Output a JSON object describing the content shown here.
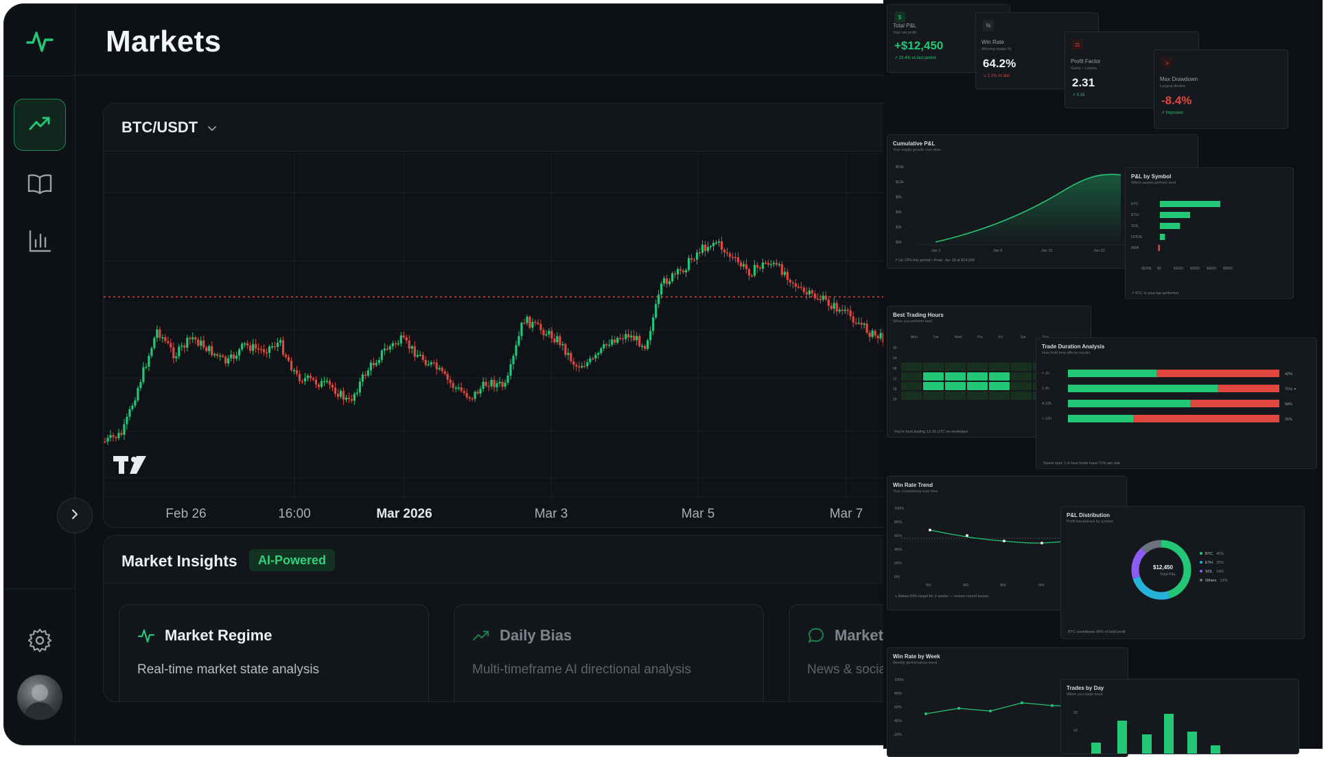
{
  "header": {
    "title": "Markets"
  },
  "symbol_selector": {
    "value": "BTC/USDT"
  },
  "chart_data": {
    "type": "candlestick",
    "symbol": "BTC/USDT",
    "x_tick_labels": [
      "Feb 26",
      "16:00",
      "Mar 2026",
      "Mar 3",
      "Mar 5",
      "Mar 7"
    ],
    "x_tick_bold": [
      false,
      false,
      true,
      false,
      false,
      false
    ],
    "reference_line_color": "#e0473f",
    "up_color": "#22c875",
    "down_color": "#e0473f",
    "close_path_approx": [
      0.85,
      0.82,
      0.62,
      0.42,
      0.52,
      0.45,
      0.5,
      0.55,
      0.48,
      0.5,
      0.47,
      0.6,
      0.62,
      0.64,
      0.7,
      0.58,
      0.5,
      0.46,
      0.52,
      0.57,
      0.64,
      0.68,
      0.62,
      0.64,
      0.38,
      0.42,
      0.46,
      0.56,
      0.54,
      0.46,
      0.44,
      0.48,
      0.24,
      0.2,
      0.12,
      0.08,
      0.15,
      0.2,
      0.16,
      0.2,
      0.28,
      0.3,
      0.34,
      0.38,
      0.44,
      0.46,
      0.47,
      0.49
    ]
  },
  "insights": {
    "title": "Market Insights",
    "badge": "AI-Powered",
    "cards": [
      {
        "title": "Market Regime",
        "desc": "Real-time market state analysis"
      },
      {
        "title": "Daily Bias",
        "desc": "Multi-timeframe AI directional analysis"
      },
      {
        "title": "Market S",
        "desc": "News & socia"
      }
    ]
  },
  "collage": {
    "stats": [
      {
        "label": "Total P&L",
        "sub": "Your net profit",
        "value": "+$12,450",
        "delta": "↗ 23.4% vs last period",
        "color": "#22c875"
      },
      {
        "label": "Win Rate",
        "sub": "Winning trades %",
        "value": "64.2%",
        "delta": "↘ 2.1% vs last",
        "color": "#e0473f"
      },
      {
        "label": "Profit Factor",
        "sub": "Gains ÷ Losses",
        "value": "2.31",
        "delta": "↗ 0.15",
        "color": "#22c875"
      },
      {
        "label": "Max Drawdown",
        "sub": "Largest decline",
        "value": "-8.4%",
        "delta": "↗ Improved",
        "color": "#22c875"
      }
    ],
    "cumulative": {
      "title": "Cumulative P&L",
      "sub": "Your equity growth over time",
      "y_ticks": [
        "$15k",
        "$12k",
        "$9k",
        "$6k",
        "$3k",
        "$0k"
      ],
      "x_ticks": [
        "Jan 1",
        "Jan 8",
        "Jan 15",
        "Jan 22"
      ],
      "footer": "↗ Up 23% this period • Peak: Jan 18 at $14,200"
    },
    "by_symbol": {
      "title": "P&L by Symbol",
      "sub": "Which assets perform best",
      "symbols": [
        "BTC",
        "ETH",
        "SOL",
        "DOGE",
        "ARB"
      ],
      "values": [
        4200,
        2100,
        1400,
        350,
        -120
      ],
      "x_ticks": [
        "-$1000",
        "$0",
        "$1000",
        "$2000",
        "$4000",
        "$5000"
      ],
      "footer": "↗ BTC is your top performer"
    },
    "hours": {
      "title": "Best Trading Hours",
      "sub": "When you perform best",
      "days": [
        "Mon",
        "Tue",
        "Wed",
        "Thu",
        "Fri",
        "Sat",
        "Sun"
      ],
      "hours": [
        "00",
        "04",
        "08",
        "12",
        "16",
        "20"
      ],
      "footer": "You're best trading 12-16 UTC on weekdays"
    },
    "duration": {
      "title": "Trade Duration Analysis",
      "sub": "How hold time affects results",
      "rows": [
        {
          "label": "< 1h",
          "win": 42,
          "text": "42%"
        },
        {
          "label": "1-4h",
          "win": 71,
          "text": "71% ✦"
        },
        {
          "label": "4-12h",
          "win": 58,
          "text": "58%"
        },
        {
          "label": "> 12h",
          "win": 31,
          "text": "31%"
        }
      ],
      "footer": "Sweet spot: 1-4 hour holds have 71% win rate"
    },
    "win_trend": {
      "title": "Win Rate Trend",
      "sub": "Your consistency over time",
      "y_ticks": [
        "100%",
        "80%",
        "60%",
        "40%",
        "20%",
        "0%"
      ],
      "x_ticks": [
        "W1",
        "W2",
        "W3",
        "W4"
      ],
      "footer": "↘ Below 60% target for 2 weeks — review recent losses"
    },
    "distribution": {
      "title": "P&L Distribution",
      "sub": "Profit breakdown by symbol",
      "center_value": "$12,450",
      "center_label": "Total P&L",
      "legend": [
        {
          "name": "BTC",
          "pct": "45%",
          "color": "#22c875"
        },
        {
          "name": "ETH",
          "pct": "25%",
          "color": "#26b3d9"
        },
        {
          "name": "SOL",
          "pct": "18%",
          "color": "#8b5cf6"
        },
        {
          "name": "Others",
          "pct": "12%",
          "color": "#6b7280"
        }
      ],
      "footer": "BTC contributes 45% of total profit"
    },
    "win_week": {
      "title": "Win Rate by Week",
      "sub": "Weekly performance trend",
      "y_ticks": [
        "100%",
        "80%",
        "60%",
        "40%",
        "20%"
      ]
    },
    "trades_day": {
      "title": "Trades by Day",
      "sub": "When you trade most",
      "y_ticks": [
        "20",
        "15"
      ]
    }
  }
}
